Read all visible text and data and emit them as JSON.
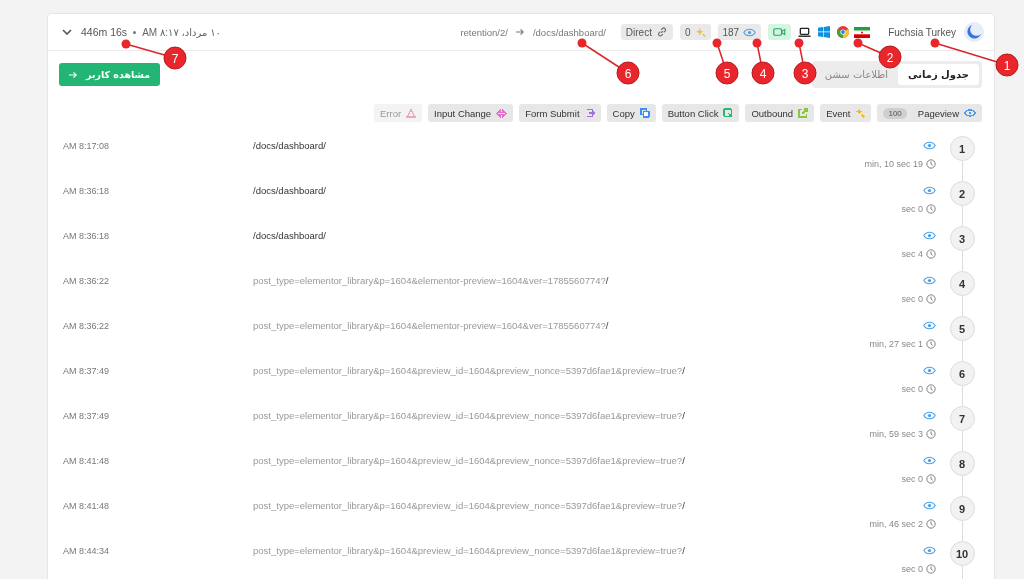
{
  "session": {
    "duration": "446m 16s",
    "date": "۱۰ مرداد، ۸:۱۷ AM",
    "entry_page": "retention/2/",
    "exit_page": "/docs/dashboard/",
    "source": "Direct",
    "clicks": "0",
    "views": "187",
    "user_name": "Fuchsia Turkey"
  },
  "view_user_button": "مشاهده کاربر",
  "tabs": [
    {
      "label": "جدول زمانی",
      "selected": true
    },
    {
      "label": "اطلاعات سشن",
      "selected": false
    }
  ],
  "filters": [
    {
      "label": "Error",
      "kind": "error",
      "color": "#f4a6b8",
      "disabled": true
    },
    {
      "label": "Input Change",
      "kind": "input",
      "color": "#e86bd0",
      "disabled": false
    },
    {
      "label": "Form Submit",
      "kind": "form",
      "color": "#a070e0",
      "disabled": false
    },
    {
      "label": "Copy",
      "kind": "copy",
      "color": "#3b8ff0",
      "disabled": false
    },
    {
      "label": "Button Click",
      "kind": "click",
      "color": "#2bb673",
      "disabled": false
    },
    {
      "label": "Outbound",
      "kind": "outbound",
      "color": "#8cc63f",
      "disabled": false
    },
    {
      "label": "Event",
      "kind": "event",
      "color": "#f5b82e",
      "disabled": false
    },
    {
      "label": "Pageview",
      "kind": "pageview",
      "color": "#4a9fe8",
      "disabled": false,
      "count": "100"
    }
  ],
  "events": [
    {
      "number": "1",
      "time": "AM 8:17:08",
      "path": "/docs/dashboard/",
      "duration": "min, 10 sec 19"
    },
    {
      "number": "2",
      "time": "AM 8:36:18",
      "path": "/docs/dashboard/",
      "duration": "sec 0"
    },
    {
      "number": "3",
      "time": "AM 8:36:18",
      "path": "/docs/dashboard/",
      "duration": "sec 4"
    },
    {
      "number": "4",
      "time": "AM 8:36:22",
      "query": "post_type=elementor_library&p=1604&elementor-preview=1604&ver=1785560774?",
      "path": "/",
      "duration": "sec 0"
    },
    {
      "number": "5",
      "time": "AM 8:36:22",
      "query": "post_type=elementor_library&p=1604&elementor-preview=1604&ver=1785560774?",
      "path": "/",
      "duration": "min, 27 sec 1"
    },
    {
      "number": "6",
      "time": "AM 8:37:49",
      "query": "post_type=elementor_library&p=1604&preview_id=1604&preview_nonce=5397d6fae1&preview=true?",
      "path": "/",
      "duration": "sec 0"
    },
    {
      "number": "7",
      "time": "AM 8:37:49",
      "query": "post_type=elementor_library&p=1604&preview_id=1604&preview_nonce=5397d6fae1&preview=true?",
      "path": "/",
      "duration": "min, 59 sec 3"
    },
    {
      "number": "8",
      "time": "AM 8:41:48",
      "query": "post_type=elementor_library&p=1604&preview_id=1604&preview_nonce=5397d6fae1&preview=true?",
      "path": "/",
      "duration": "sec 0"
    },
    {
      "number": "9",
      "time": "AM 8:41:48",
      "query": "post_type=elementor_library&p=1604&preview_id=1604&preview_nonce=5397d6fae1&preview=true?",
      "path": "/",
      "duration": "min, 46 sec 2"
    },
    {
      "number": "10",
      "time": "AM 8:44:34",
      "query": "post_type=elementor_library&p=1604&preview_id=1604&preview_nonce=5397d6fae1&preview=true?",
      "path": "/",
      "duration": "sec 0"
    }
  ],
  "callouts": [
    {
      "label": "7"
    },
    {
      "label": "6"
    },
    {
      "label": "5"
    },
    {
      "label": "4"
    },
    {
      "label": "3"
    },
    {
      "label": "2"
    },
    {
      "label": "1"
    }
  ]
}
